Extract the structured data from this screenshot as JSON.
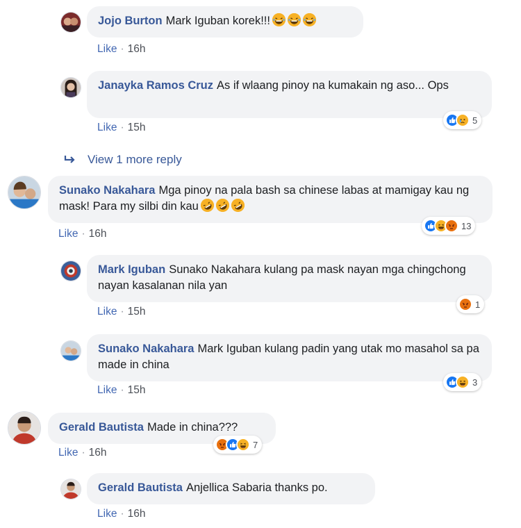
{
  "comments": [
    {
      "author": "Jojo Burton",
      "text": "Mark Iguban korek!!!",
      "emojis": [
        "laugh-tears-emoji",
        "laugh-tears-emoji",
        "laugh-tears-emoji"
      ],
      "like_label": "Like",
      "time": "16h"
    },
    {
      "author": "Janayka Ramos Cruz",
      "text": "As if wlaang pinoy na kumakain ng aso... Ops",
      "like_label": "Like",
      "time": "15h",
      "reactions": [
        "like",
        "sad"
      ],
      "reaction_count": "5"
    },
    {
      "author": "Sunako Nakahara",
      "text": "Mga pinoy na pala bash sa chinese labas at mamigay kau ng mask! Para my silbi din kau",
      "emojis": [
        "rofl-emoji",
        "rofl-emoji",
        "rofl-emoji"
      ],
      "like_label": "Like",
      "time": "16h",
      "reactions": [
        "like",
        "haha",
        "angry"
      ],
      "reaction_count": "13"
    },
    {
      "author": "Mark Iguban",
      "text": "Sunako Nakahara kulang pa mask nayan mga chingchong nayan kasalanan nila yan",
      "like_label": "Like",
      "time": "15h",
      "reactions": [
        "angry"
      ],
      "reaction_count": "1"
    },
    {
      "author": "Sunako Nakahara",
      "text": "Mark Iguban kulang padin yang utak mo masahol sa pa made in china",
      "like_label": "Like",
      "time": "15h",
      "reactions": [
        "like",
        "haha"
      ],
      "reaction_count": "3"
    },
    {
      "author": "Gerald Bautista",
      "text": "Made in china???",
      "like_label": "Like",
      "time": "16h",
      "reactions": [
        "angry",
        "like",
        "haha"
      ],
      "reaction_count": "7"
    },
    {
      "author": "Gerald Bautista",
      "text": "Anjellica Sabaria thanks po.",
      "like_label": "Like",
      "time": "16h"
    }
  ],
  "view_more": {
    "label": "View 1 more reply"
  },
  "colors": {
    "link": "#385898",
    "like": "#4267b2",
    "bubble": "#f2f3f5",
    "react_like": "#1877f2",
    "react_angry": "#e9710f",
    "react_yellow": "#f7b125"
  }
}
